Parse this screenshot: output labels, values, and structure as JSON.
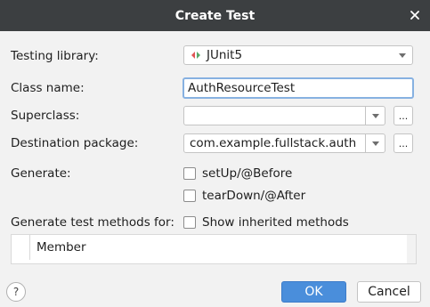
{
  "dialog": {
    "title": "Create Test",
    "close_icon": "close-icon"
  },
  "form": {
    "testing_library": {
      "label": "Testing library:",
      "value": "JUnit5",
      "icon": "junit-icon"
    },
    "class_name": {
      "label": "Class name:",
      "value": "AuthResourceTest"
    },
    "superclass": {
      "label": "Superclass:",
      "value": "",
      "browse": "..."
    },
    "destination_package": {
      "label": "Destination package:",
      "value": "com.example.fullstack.auth",
      "browse": "..."
    },
    "generate": {
      "label": "Generate:",
      "options": [
        {
          "label": "setUp/@Before",
          "checked": false
        },
        {
          "label": "tearDown/@After",
          "checked": false
        }
      ]
    },
    "generate_test_methods": {
      "label": "Generate test methods for:",
      "show_inherited": {
        "label": "Show inherited methods",
        "checked": false
      }
    }
  },
  "members_table": {
    "column": "Member",
    "rows": []
  },
  "footer": {
    "help": "?",
    "ok": "OK",
    "cancel": "Cancel"
  },
  "colors": {
    "titlebar": "#3c3f41",
    "ok_button": "#4a8edb",
    "focus_border": "#87b1e1",
    "junit_green": "#59a869",
    "junit_red": "#e05555"
  }
}
